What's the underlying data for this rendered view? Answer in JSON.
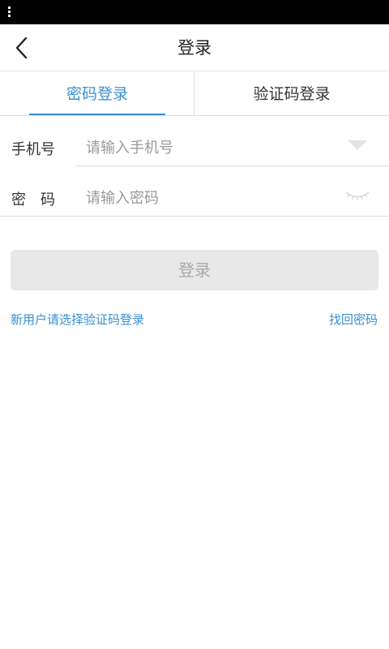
{
  "header": {
    "title": "登录"
  },
  "tabs": [
    {
      "label": "密码登录",
      "active": true
    },
    {
      "label": "验证码登录",
      "active": false
    }
  ],
  "form": {
    "phone": {
      "label": "手机号",
      "value": "",
      "placeholder": "请输入手机号"
    },
    "password": {
      "label": "密　码",
      "value": "",
      "placeholder": "请输入密码"
    }
  },
  "actions": {
    "login_label": "登录",
    "new_user_link": "新用户请选择验证码登录",
    "forgot_link": "找回密码"
  },
  "icons": {
    "back": "chevron-left-icon",
    "dropdown": "triangle-down-icon",
    "eye": "eye-closed-icon"
  },
  "colors": {
    "accent": "#3a8fd0",
    "button_disabled_bg": "#e8e8e8",
    "button_disabled_text": "#aaaaaa"
  }
}
